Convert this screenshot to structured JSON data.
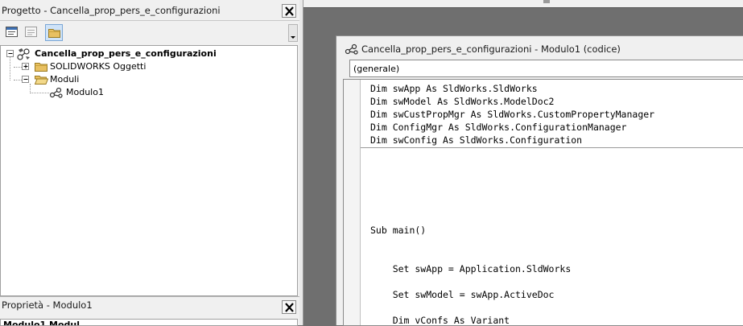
{
  "project_panel": {
    "title": "Progetto - Cancella_prop_pers_e_configurazioni",
    "tree": [
      {
        "label": "Cancella_prop_pers_e_configurazioni",
        "bold": true
      },
      {
        "label": "SOLIDWORKS Oggetti"
      },
      {
        "label": "Moduli"
      },
      {
        "label": "Modulo1"
      }
    ]
  },
  "properties_panel": {
    "title": "Proprietà - Modulo1",
    "peek_text": "Modulo1 Modul"
  },
  "code_window": {
    "title": "Cancella_prop_pers_e_configurazioni - Modulo1 (codice)",
    "object_combo": "(generale)",
    "declarations": [
      "Dim swApp As SldWorks.SldWorks",
      "Dim swModel As SldWorks.ModelDoc2",
      "Dim swCustPropMgr As SldWorks.CustomPropertyManager",
      "Dim ConfigMgr As SldWorks.ConfigurationManager",
      "Dim swConfig As SldWorks.Configuration"
    ],
    "body": [
      "Sub main()",
      "    Set swApp = Application.SldWorks",
      "    Set swModel = swApp.ActiveDoc",
      "    Dim vConfs As Variant"
    ]
  },
  "icons": {
    "close": "close-icon",
    "view_code": "view-code-icon",
    "view_object": "view-object-icon",
    "toggle_folders": "folder-icon",
    "project": "vba-project-icon",
    "module": "module-icon"
  },
  "colors": {
    "mdi_background": "#6f6f6f",
    "panel": "#f0f0f0",
    "folder": "#e8c061"
  }
}
